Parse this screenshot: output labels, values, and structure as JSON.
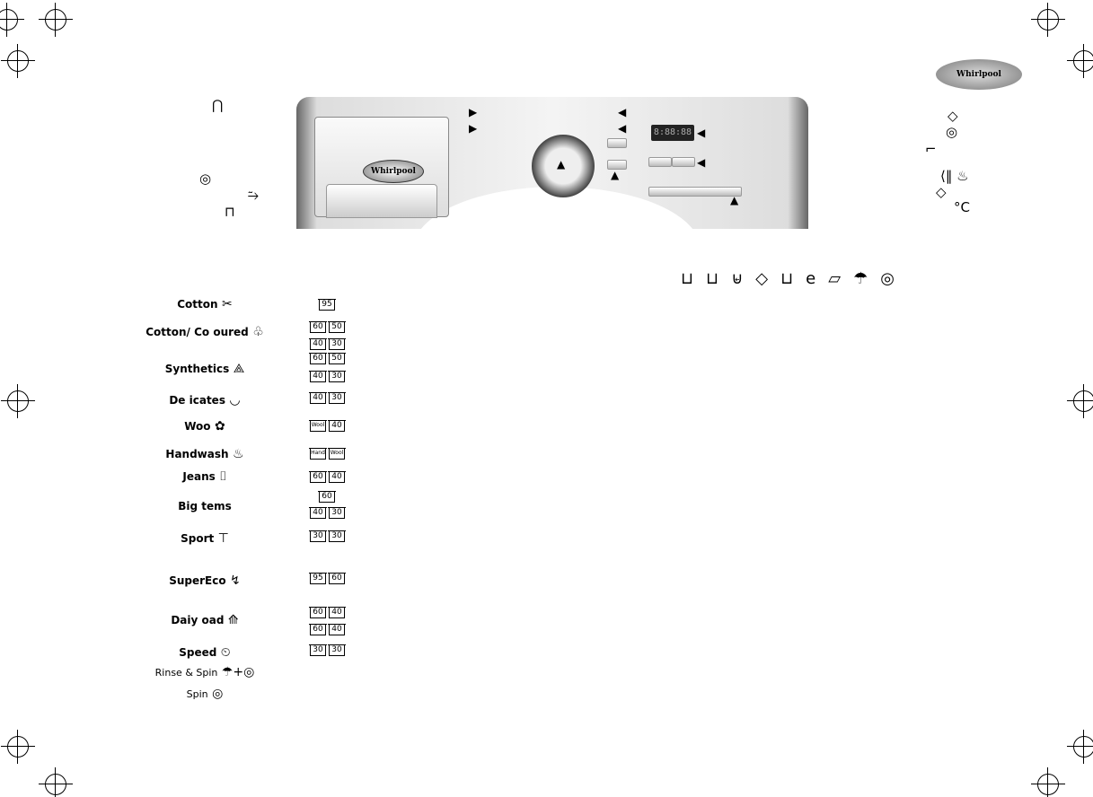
{
  "brand": "Whirlpool",
  "panel": {
    "display": "8:88:88"
  },
  "programs": [
    {
      "label": "Cotton",
      "temps": [
        "95"
      ]
    },
    {
      "label": "Cotton/ Co oured",
      "temps": [
        "60",
        "50",
        "40",
        "30"
      ]
    },
    {
      "label": "Synthetics",
      "temps": [
        "60",
        "50",
        "40",
        "30"
      ]
    },
    {
      "label": "De icates",
      "temps": [
        "40",
        "30"
      ]
    },
    {
      "label": "Woo",
      "temps": [
        "Wool",
        "40"
      ]
    },
    {
      "label": "Handwash",
      "temps": [
        "Hand",
        "Wool"
      ]
    },
    {
      "label": "Jeans",
      "temps": [
        "60",
        "40"
      ]
    },
    {
      "label": "Big tems",
      "temps": [
        "60",
        "40",
        "30"
      ]
    },
    {
      "label": "Sport",
      "temps": [
        "30",
        "30"
      ]
    },
    {
      "label": "SuperEco",
      "temps": [
        "95",
        "60"
      ]
    },
    {
      "label": "Daiy oad",
      "temps": [
        "60",
        "40",
        "60",
        "40"
      ]
    },
    {
      "label": "Speed",
      "temps": [
        "30",
        "30"
      ]
    },
    {
      "label": "Rinse & Spin",
      "temps": []
    },
    {
      "label": "Spin",
      "temps": []
    }
  ],
  "right_symbols": {
    "start": "◇",
    "spin": "◎",
    "temp_unit": "°C"
  },
  "legend_icons": [
    "prewash-tub",
    "main-wash-tub",
    "stain-tub",
    "softener-diamond",
    "wash-tub",
    "eco",
    "iron",
    "rinse",
    "spin"
  ]
}
